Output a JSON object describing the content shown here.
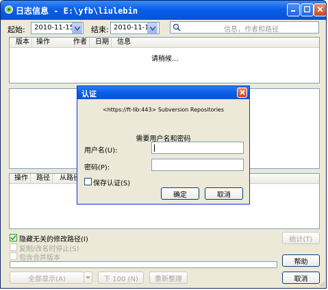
{
  "window": {
    "title": "日志信息 - E:\\yfb\\liulebin",
    "minimize_icon": "minimize-icon",
    "maximize_icon": "maximize-icon",
    "close_icon": "close-icon"
  },
  "filter": {
    "from_label": "起始:",
    "from_value": "2010-11-15",
    "to_label": "结束:",
    "to_value": "2010-11-15",
    "search_placeholder": "信息，作者和路径"
  },
  "revision_list": {
    "columns": [
      "版本",
      "操作",
      "作者",
      "日期",
      "信息"
    ],
    "status": "请稍候..."
  },
  "paths_list": {
    "columns": [
      "操作",
      "路径",
      "从路径"
    ]
  },
  "options": {
    "hide_unrelated": "隐藏无关的修改路径(I)",
    "stop_on_copy": "复制/改名时停止(S)",
    "include_merged": "包含合并版本"
  },
  "buttons": {
    "stats": "统计(T)",
    "help": "帮助",
    "show_all": "全部显示(A)",
    "next_100": "下 100 (N)",
    "refresh": "重新整理",
    "cancel": "取消"
  },
  "auth_dialog": {
    "title": "认证",
    "realm": "<https://ft-lib:443> Subversion Repositories",
    "prompt": "需要用户名和密码",
    "username_label": "用户名(U):",
    "username_value": "",
    "password_label": "密码(P):",
    "password_value": "",
    "save_auth": "保存认证(S)",
    "ok": "确定",
    "cancel": "取消"
  },
  "colors": {
    "titlebar": "#0a5ee8",
    "window_bg": "#ece9d8",
    "close_red": "#c7461f",
    "checkbox_green": "#2d9b2d"
  }
}
